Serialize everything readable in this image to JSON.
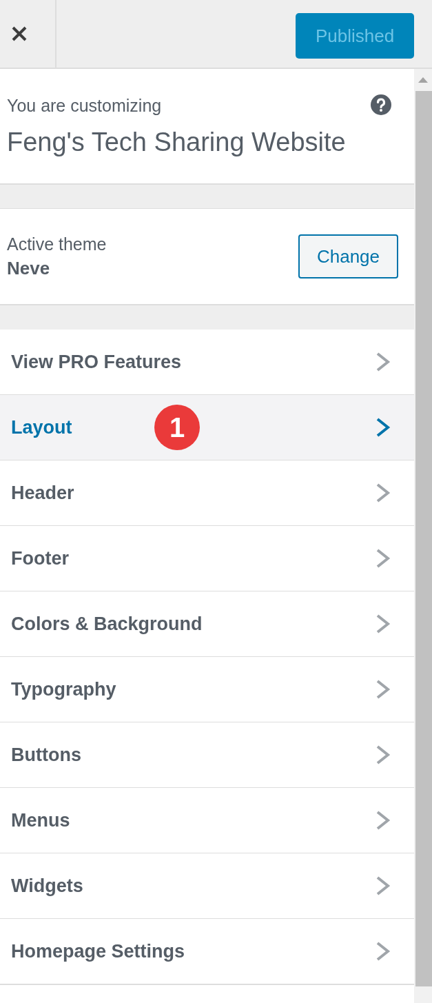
{
  "top_bar": {
    "publish_button": {
      "label": "Published",
      "disabled": true
    }
  },
  "info": {
    "label": "You are customizing",
    "site_title": "Feng's Tech Sharing Website"
  },
  "theme": {
    "label": "Active theme",
    "name": "Neve",
    "button": "Change"
  },
  "menu": {
    "items": [
      {
        "label": "View PRO Features",
        "selected": false
      },
      {
        "label": "Layout",
        "selected": true,
        "badge": "1"
      },
      {
        "label": "Header",
        "selected": false
      },
      {
        "label": "Footer",
        "selected": false
      },
      {
        "label": "Colors & Background",
        "selected": false
      },
      {
        "label": "Typography",
        "selected": false
      },
      {
        "label": "Buttons",
        "selected": false
      },
      {
        "label": "Menus",
        "selected": false
      },
      {
        "label": "Widgets",
        "selected": false
      },
      {
        "label": "Homepage Settings",
        "selected": false
      }
    ]
  }
}
